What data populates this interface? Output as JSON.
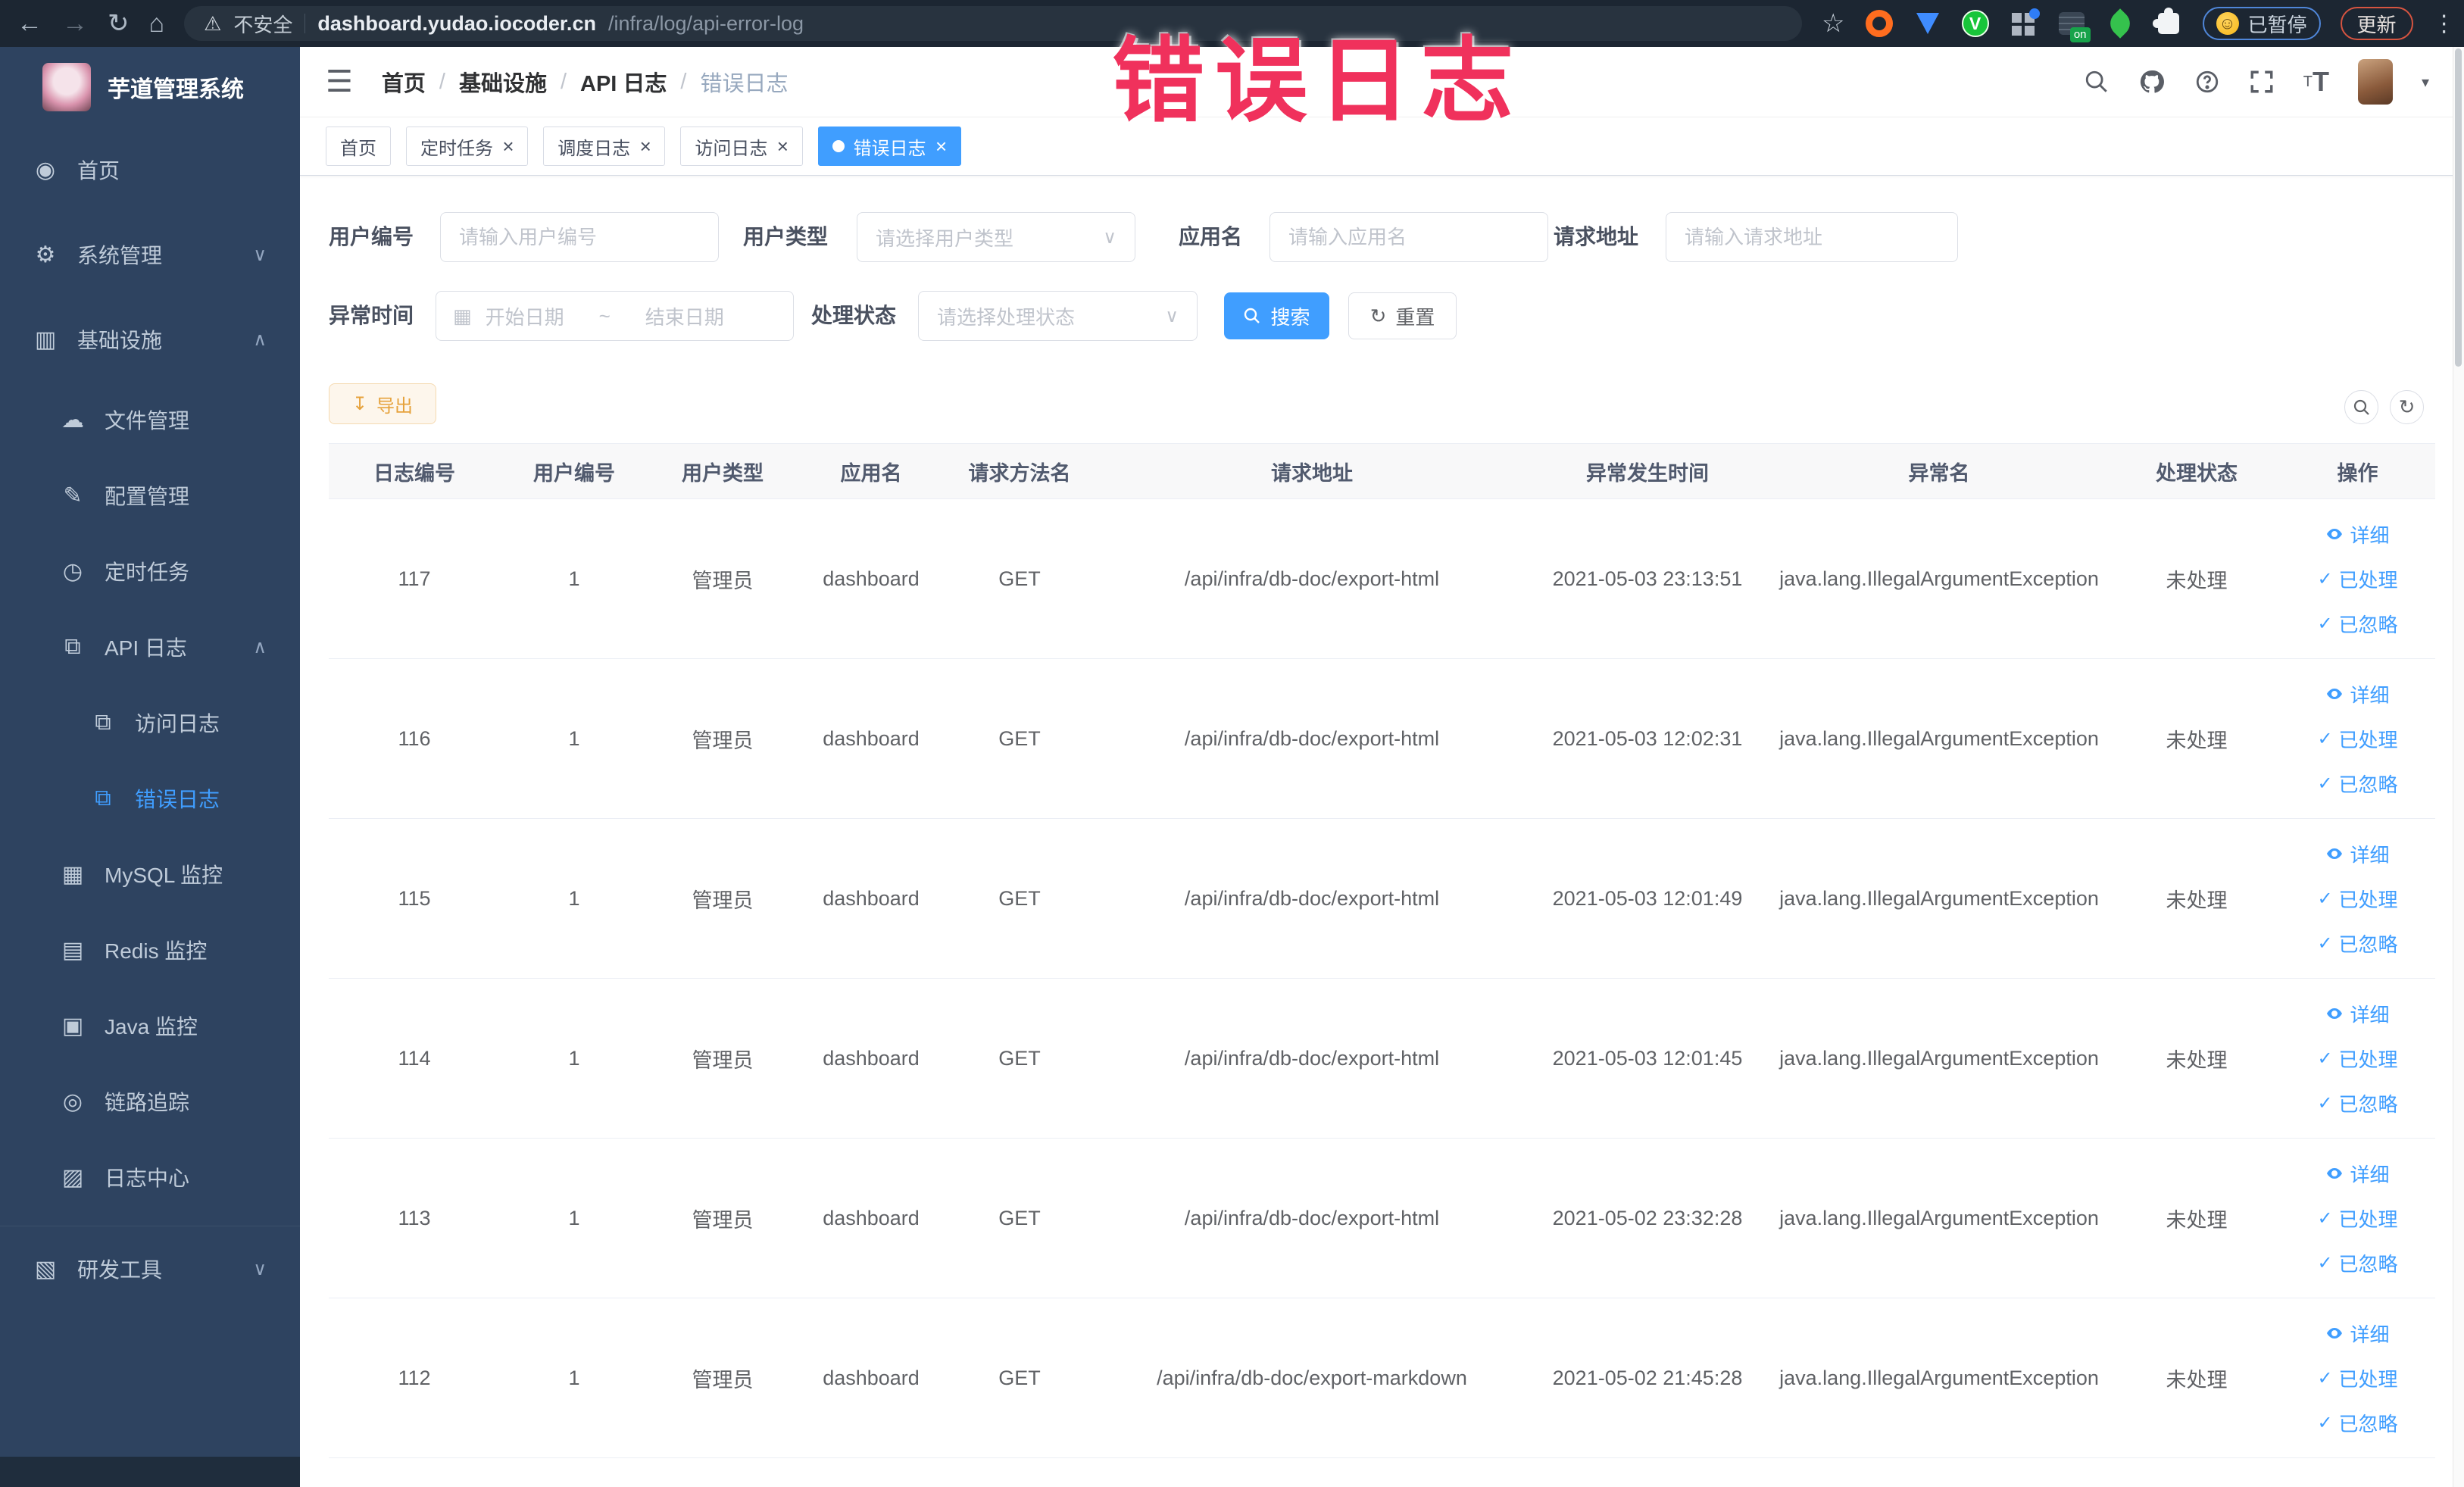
{
  "browser": {
    "security_label": "不安全",
    "url_domain": "dashboard.yudao.iocoder.cn",
    "url_path": "/infra/log/api-error-log",
    "extension_paused_label": "已暂停",
    "update_button_label": "更新"
  },
  "annotation": {
    "text": "错误日志",
    "color": "#f0315c"
  },
  "app": {
    "title": "芋道管理系统",
    "sidebar": {
      "items": [
        {
          "key": "home",
          "label": "首页",
          "icon": "dashboard",
          "level": 0
        },
        {
          "key": "system",
          "label": "系统管理",
          "icon": "gear",
          "level": 0,
          "chevron": "down"
        },
        {
          "key": "infra",
          "label": "基础设施",
          "icon": "monitor",
          "level": 0,
          "chevron": "up"
        },
        {
          "key": "file",
          "label": "文件管理",
          "icon": "cloud",
          "level": 1
        },
        {
          "key": "config",
          "label": "配置管理",
          "icon": "edit",
          "level": 1
        },
        {
          "key": "job",
          "label": "定时任务",
          "icon": "timer",
          "level": 1
        },
        {
          "key": "api-log",
          "label": "API 日志",
          "icon": "log",
          "level": 1,
          "chevron": "up"
        },
        {
          "key": "access-log",
          "label": "访问日志",
          "icon": "log",
          "level": 2
        },
        {
          "key": "error-log",
          "label": "错误日志",
          "icon": "log",
          "level": 2,
          "active": true
        },
        {
          "key": "mysql",
          "label": "MySQL 监控",
          "icon": "chart",
          "level": 1
        },
        {
          "key": "redis",
          "label": "Redis 监控",
          "icon": "layers",
          "level": 1
        },
        {
          "key": "java",
          "label": "Java 监控",
          "icon": "java",
          "level": 1
        },
        {
          "key": "trace",
          "label": "链路追踪",
          "icon": "eye",
          "level": 1
        },
        {
          "key": "log-center",
          "label": "日志中心",
          "icon": "doc",
          "level": 1
        },
        {
          "key": "devtools",
          "label": "研发工具",
          "icon": "briefcase",
          "level": 0,
          "chevron": "down",
          "gapTop": true
        }
      ]
    },
    "breadcrumb": [
      "首页",
      "基础设施",
      "API 日志",
      "错误日志"
    ],
    "tags": [
      {
        "label": "首页",
        "closable": false,
        "active": false
      },
      {
        "label": "定时任务",
        "closable": true,
        "active": false
      },
      {
        "label": "调度日志",
        "closable": true,
        "active": false
      },
      {
        "label": "访问日志",
        "closable": true,
        "active": false
      },
      {
        "label": "错误日志",
        "closable": true,
        "active": true
      }
    ],
    "filters": {
      "user_id_label": "用户编号",
      "user_id_placeholder": "请输入用户编号",
      "user_type_label": "用户类型",
      "user_type_placeholder": "请选择用户类型",
      "app_name_label": "应用名",
      "app_name_placeholder": "请输入应用名",
      "request_url_label": "请求地址",
      "request_url_placeholder": "请输入请求地址",
      "exception_time_label": "异常时间",
      "date_start_placeholder": "开始日期",
      "date_separator": "~",
      "date_end_placeholder": "结束日期",
      "process_status_label": "处理状态",
      "process_status_placeholder": "请选择处理状态",
      "search_label": "搜索",
      "reset_label": "重置"
    },
    "toolbar": {
      "export_label": "导出"
    },
    "table": {
      "columns": [
        "日志编号",
        "用户编号",
        "用户类型",
        "应用名",
        "请求方法名",
        "请求地址",
        "异常发生时间",
        "异常名",
        "处理状态",
        "操作"
      ],
      "rows": [
        {
          "id": "117",
          "user_id": "1",
          "user_type": "管理员",
          "app": "dashboard",
          "method": "GET",
          "url": "/api/infra/db-doc/export-html",
          "time": "2021-05-03 23:13:51",
          "exception": "java.lang.IllegalArgumentException",
          "status": "未处理"
        },
        {
          "id": "116",
          "user_id": "1",
          "user_type": "管理员",
          "app": "dashboard",
          "method": "GET",
          "url": "/api/infra/db-doc/export-html",
          "time": "2021-05-03 12:02:31",
          "exception": "java.lang.IllegalArgumentException",
          "status": "未处理"
        },
        {
          "id": "115",
          "user_id": "1",
          "user_type": "管理员",
          "app": "dashboard",
          "method": "GET",
          "url": "/api/infra/db-doc/export-html",
          "time": "2021-05-03 12:01:49",
          "exception": "java.lang.IllegalArgumentException",
          "status": "未处理"
        },
        {
          "id": "114",
          "user_id": "1",
          "user_type": "管理员",
          "app": "dashboard",
          "method": "GET",
          "url": "/api/infra/db-doc/export-html",
          "time": "2021-05-03 12:01:45",
          "exception": "java.lang.IllegalArgumentException",
          "status": "未处理"
        },
        {
          "id": "113",
          "user_id": "1",
          "user_type": "管理员",
          "app": "dashboard",
          "method": "GET",
          "url": "/api/infra/db-doc/export-html",
          "time": "2021-05-02 23:32:28",
          "exception": "java.lang.IllegalArgumentException",
          "status": "未处理"
        },
        {
          "id": "112",
          "user_id": "1",
          "user_type": "管理员",
          "app": "dashboard",
          "method": "GET",
          "url": "/api/infra/db-doc/export-markdown",
          "time": "2021-05-02 21:45:28",
          "exception": "java.lang.IllegalArgumentException",
          "status": "未处理"
        }
      ],
      "row_actions": [
        "详细",
        "已处理",
        "已忽略"
      ]
    }
  },
  "colors": {
    "accent": "#409eff",
    "sidebar_bg": "#2e4360",
    "warning": "#e6a23c",
    "annotation": "#f0315c"
  }
}
